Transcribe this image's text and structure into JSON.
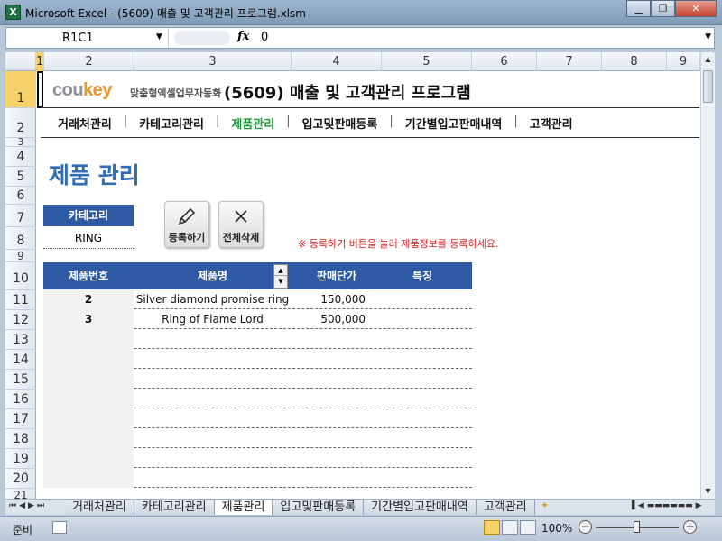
{
  "window": {
    "title": "Microsoft Excel - (5609) 매출 및 고객관리 프로그램.xlsm",
    "app_icon_letter": "X",
    "minimize_icon": "minimize-icon",
    "maximize_icon": "restore-icon",
    "close_icon": "close-icon"
  },
  "formula_bar": {
    "name_box": "R1C1",
    "fx_label": "fx",
    "value": "0"
  },
  "columns": [
    "1",
    "2",
    "3",
    "4",
    "5",
    "6",
    "7",
    "8",
    "9"
  ],
  "rows": [
    "1",
    "2",
    "3",
    "4",
    "5",
    "6",
    "7",
    "8",
    "9",
    "10",
    "11",
    "12",
    "13",
    "14",
    "15",
    "16",
    "17",
    "18",
    "19",
    "20",
    "21"
  ],
  "header": {
    "brand_main": "cou",
    "brand_accent": "key",
    "brand_tag": "맞춤형엑셀업무자동화",
    "program_title": "(5609) 매출 및 고객관리 프로그램"
  },
  "nav": {
    "items": [
      "거래처관리",
      "카테고리관리",
      "제품관리",
      "입고및판매등록",
      "기간별입고판매내역",
      "고객관리"
    ],
    "separator": "|",
    "active_index": 2
  },
  "page": {
    "title": "제품 관리",
    "category_label": "카테고리",
    "category_value": "RING",
    "register_button": "등록하기",
    "delete_all_button": "전체삭제",
    "notice": "※ 등록하기 버튼을 눌러 제품정보를 등록하세요."
  },
  "table": {
    "headers": {
      "no": "제품번호",
      "name": "제품명",
      "price": "판매단가",
      "feature": "특징"
    },
    "rows": [
      {
        "no": "2",
        "name": "Silver diamond promise ring",
        "price": "150,000",
        "feature": ""
      },
      {
        "no": "3",
        "name": "Ring of Flame Lord",
        "price": "500,000",
        "feature": ""
      },
      {
        "no": "",
        "name": "",
        "price": "",
        "feature": ""
      },
      {
        "no": "",
        "name": "",
        "price": "",
        "feature": ""
      },
      {
        "no": "",
        "name": "",
        "price": "",
        "feature": ""
      },
      {
        "no": "",
        "name": "",
        "price": "",
        "feature": ""
      },
      {
        "no": "",
        "name": "",
        "price": "",
        "feature": ""
      },
      {
        "no": "",
        "name": "",
        "price": "",
        "feature": ""
      },
      {
        "no": "",
        "name": "",
        "price": "",
        "feature": ""
      },
      {
        "no": "",
        "name": "",
        "price": "",
        "feature": ""
      }
    ]
  },
  "sheet_tabs": {
    "tabs": [
      "거래처관리",
      "카테고리관리",
      "제품관리",
      "입고및판매등록",
      "기간별입고판매내역",
      "고객관리"
    ],
    "active_index": 2
  },
  "status": {
    "mode": "준비",
    "zoom": "100%",
    "zoom_out": "−",
    "zoom_in": "+"
  },
  "colors": {
    "header_blue": "#2e5aa3",
    "title_blue": "#2e6cb5",
    "nav_active": "#1e9a3d",
    "notice_red": "#d21e1e",
    "selection": "#f7d26a"
  }
}
